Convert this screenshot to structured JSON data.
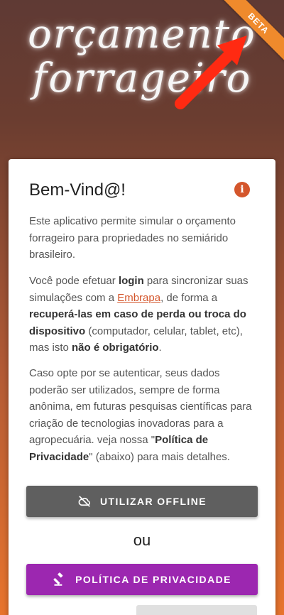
{
  "logo": {
    "line1": "orçamento",
    "line2": "forrageiro"
  },
  "ribbon": {
    "label": "BETA",
    "color": "#ef8a2c"
  },
  "card": {
    "title": "Bem-Vind@!",
    "info_icon": "info-icon",
    "paragraph1": "Este aplicativo permite simular o orçamento forrageiro para propriedades no semiárido brasileiro.",
    "paragraph2": {
      "t1": "Você pode efetuar ",
      "b1": "login",
      "t2": " para sincronizar suas simulações com a ",
      "link": "Embrapa",
      "t3": ", de forma a ",
      "b2": "recuperá-las em caso de perda ou troca do dispositivo",
      "t4": " (computador, celular, tablet, etc), mas isto ",
      "b3": "não é obrigatório",
      "t5": "."
    },
    "paragraph3": {
      "t1": "Caso opte por se autenticar, seus dados poderão ser utilizados, sempre de forma anônima, em futuras pesquisas científicas para criação de tecnologias inovadoras para a agropecuária. veja nossa \"",
      "b1": "Política de Privacidade",
      "t2": "\" (abaixo) para mais detalhes."
    },
    "offline_button": {
      "label": "UTILIZAR OFFLINE",
      "icon": "cloud-off-icon",
      "color": "#5f5f5f"
    },
    "separator": "ou",
    "privacy_button": {
      "label": "POLÍTICA DE PRIVACIDADE",
      "icon": "gavel-icon",
      "color": "#9c27b0"
    }
  },
  "colors": {
    "accent": "#d4562c",
    "background_top": "#5f3a34",
    "background_bottom": "#e8742d"
  }
}
